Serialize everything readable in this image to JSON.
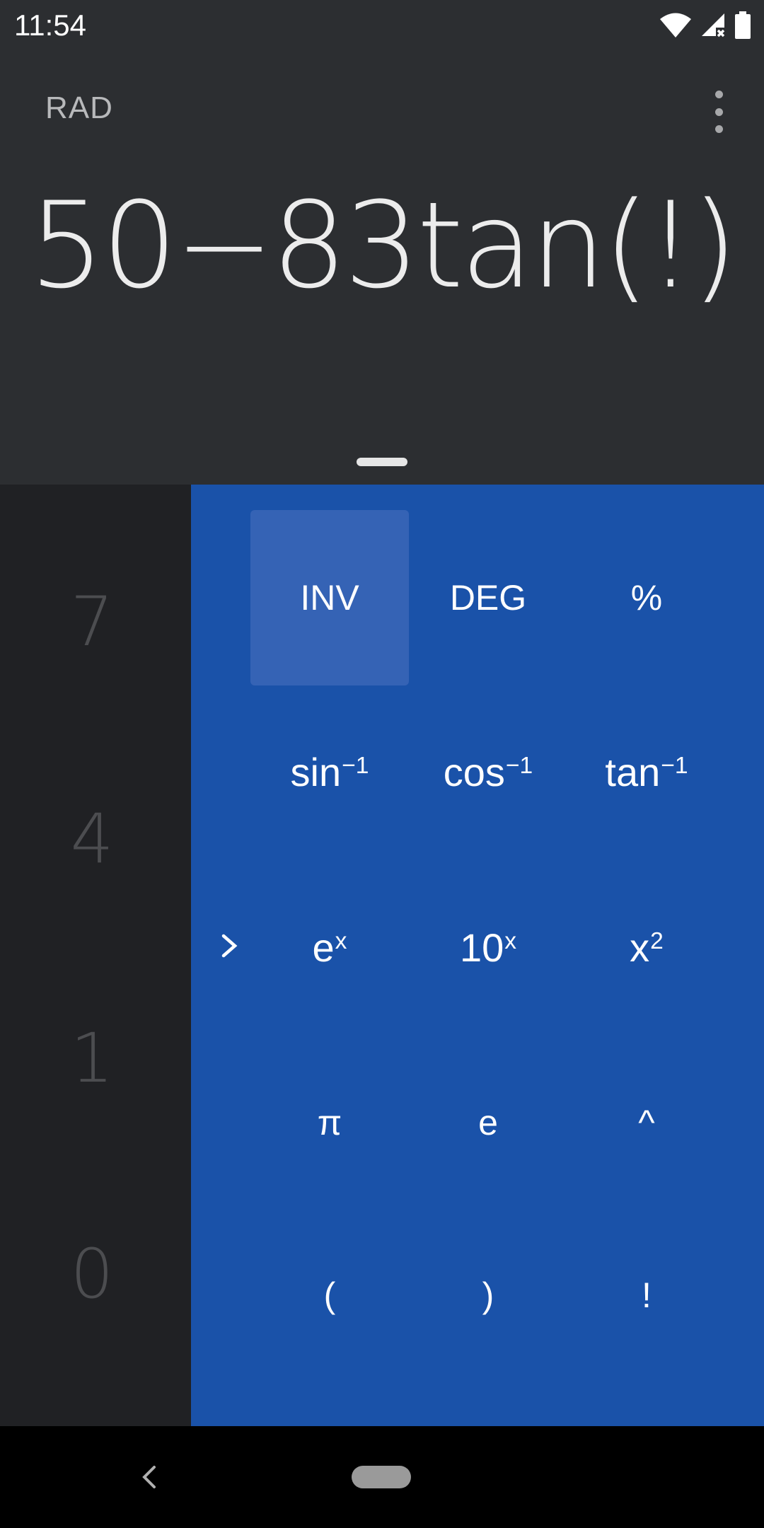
{
  "status_bar": {
    "time": "11:54",
    "icons": [
      "wifi-icon",
      "signal-icon",
      "battery-icon"
    ]
  },
  "display": {
    "angle_mode": "RAD",
    "formula": "50−83tan(!)"
  },
  "numpad": {
    "keys": [
      "7",
      "4",
      "1",
      "0"
    ]
  },
  "scientific": {
    "row1": {
      "inv": "INV",
      "deg": "DEG",
      "percent": "%"
    },
    "row2": {
      "asin_base": "sin",
      "asin_sup": "−1",
      "acos_base": "cos",
      "acos_sup": "−1",
      "atan_base": "tan",
      "atan_sup": "−1"
    },
    "row3": {
      "exp_base": "e",
      "exp_sup": "x",
      "pow10_base": "10",
      "pow10_sup": "x",
      "square_base": "x",
      "square_sup": "2"
    },
    "row4": {
      "pi": "π",
      "e": "e",
      "power": "^"
    },
    "row5": {
      "lparen": "(",
      "rparen": ")",
      "factorial": "!"
    }
  },
  "colors": {
    "display_bg": "#2c2e31",
    "numpad_bg": "#202124",
    "sci_bg": "#1a52a9",
    "sci_active": "#3563b5"
  }
}
